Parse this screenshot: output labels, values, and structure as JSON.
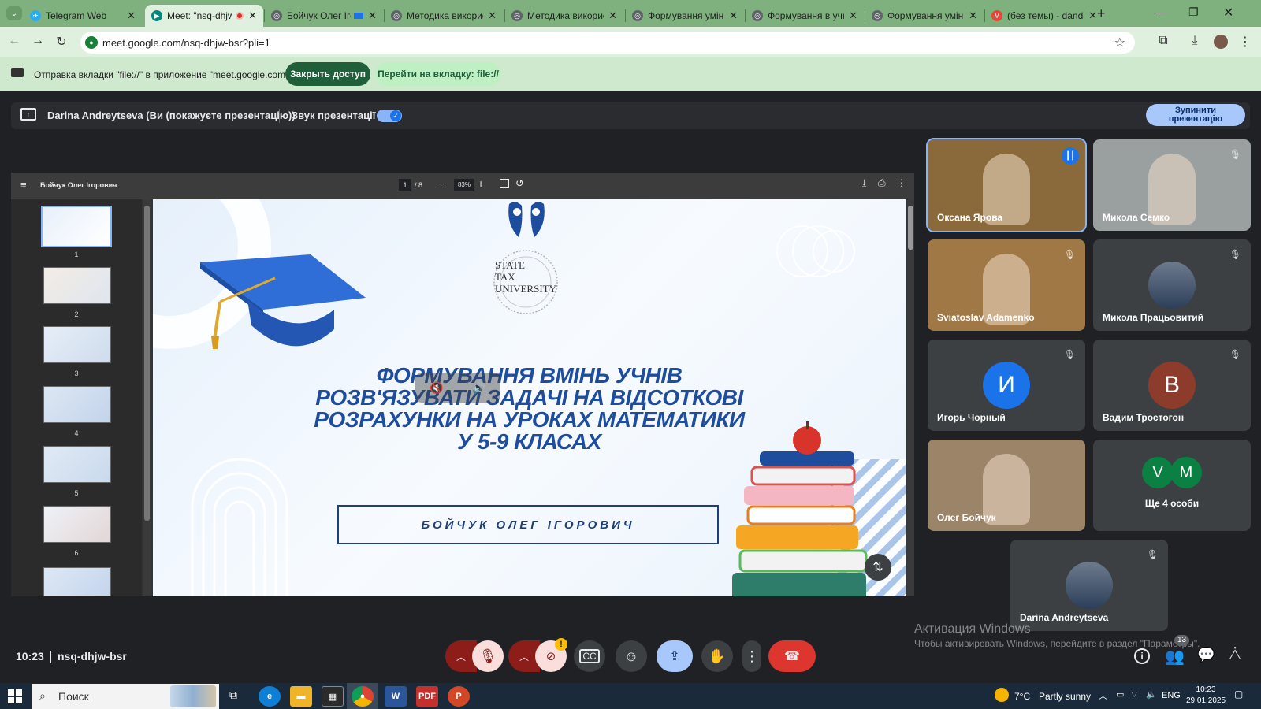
{
  "browser": {
    "tabs": [
      {
        "title": "Telegram Web",
        "favicon_color": "#2aabee",
        "glyph": "✈"
      },
      {
        "title": "Meet: \"nsq-dhjw-",
        "favicon_color": "#00897b",
        "glyph": "▶",
        "recording": true
      },
      {
        "title": "Бойчук Олег Ігор",
        "favicon_color": "#5f6368",
        "glyph": "◎"
      },
      {
        "title": "Методика використ",
        "favicon_color": "#5f6368",
        "glyph": "◎"
      },
      {
        "title": "Методика використ",
        "favicon_color": "#5f6368",
        "glyph": "◎"
      },
      {
        "title": "Формування умінь у",
        "favicon_color": "#5f6368",
        "glyph": "◎"
      },
      {
        "title": "Формування в учнів",
        "favicon_color": "#5f6368",
        "glyph": "◎"
      },
      {
        "title": "Формування умінь у",
        "favicon_color": "#5f6368",
        "glyph": "◎"
      },
      {
        "title": "(без темы) - dandrey",
        "favicon_color": "#ea4335",
        "glyph": "M"
      }
    ],
    "url": "meet.google.com/nsq-dhjw-bsr?pli=1"
  },
  "notification": {
    "text": "Отправка вкладки \"file://\" в приложение \"meet.google.com\"...",
    "stop_label": "Закрыть доступ",
    "switch_label": "Перейти на вкладку: file://"
  },
  "presenting": {
    "text": "Darina Andreytseva (Ви (покажуєте презентацію))",
    "audio_label": "Звук презентації",
    "stop_label_line1": "Зупинити",
    "stop_label_line2": "презентацію"
  },
  "pdf": {
    "filename": "Бойчук Олег Ігорович",
    "page": "1",
    "page_total": "/ 8",
    "zoom": "83%",
    "thumbnails": [
      "1",
      "2",
      "3",
      "4",
      "5",
      "6"
    ]
  },
  "slide": {
    "logo_text_1": "STATE",
    "logo_text_2": "TAX",
    "logo_text_3": "UNIVERSITY",
    "title_lines": [
      "ФОРМУВАННЯ ВМІНЬ УЧНІВ",
      "РОЗВ'ЯЗУВАТИ ЗАДАЧІ НА ВІДСОТКОВІ",
      "РОЗРАХУНКИ НА УРОКАХ МАТЕМАТИКИ",
      "У 5-9 КЛАСАХ"
    ],
    "author": "БОЙЧУК ОЛЕГ ІГОРОВИЧ"
  },
  "participants": [
    {
      "name": "Оксана Ярова",
      "kind": "video",
      "bg": "#8a6a3a",
      "speaking": true
    },
    {
      "name": "Микола Семко",
      "kind": "video",
      "bg": "#9aa0a0",
      "muted": true
    },
    {
      "name": "Sviatoslav Adamenko",
      "kind": "video",
      "bg": "#a07845",
      "muted": true
    },
    {
      "name": "Микола Працьовитий",
      "kind": "photo",
      "bg": "#3c4043",
      "muted": true
    },
    {
      "name": "Игорь Чорный",
      "kind": "initial",
      "initial": "И",
      "color": "#1a73e8",
      "muted": true
    },
    {
      "name": "Вадим Тростогон",
      "kind": "initial",
      "initial": "В",
      "color": "#8d3c2c",
      "muted": true
    },
    {
      "name": "Олег Бойчук",
      "kind": "video",
      "bg": "#9b8468"
    },
    {
      "name": "Ще 4 особи",
      "kind": "group",
      "initials": [
        "V",
        "M"
      ],
      "colors": [
        "#0b8043",
        "#0b8043"
      ]
    },
    {
      "name": "Darina Andreytseva",
      "kind": "photo",
      "bg": "#3c4043",
      "muted": true
    }
  ],
  "meeting": {
    "time": "10:23",
    "code": "nsq-dhjw-bsr",
    "people_count": "13"
  },
  "windows_watermark": {
    "line1": "Активация Windows",
    "line2": "Чтобы активировать Windows, перейдите в раздел \"Параметры\"."
  },
  "taskbar": {
    "search_placeholder": "Поиск",
    "weather_temp": "7°C",
    "weather_text": "Partly sunny",
    "lang": "ENG",
    "clock_time": "10:23",
    "clock_date": "29.01.2025"
  }
}
